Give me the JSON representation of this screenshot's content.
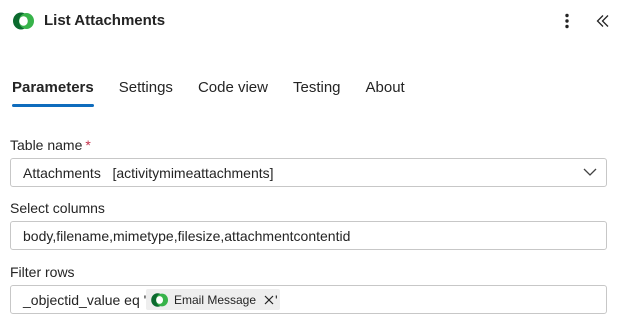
{
  "header": {
    "title": "List Attachments",
    "more_icon": "more-vertical-icon",
    "collapse_icon": "double-chevron-left-icon"
  },
  "tabs": [
    {
      "label": "Parameters",
      "active": true
    },
    {
      "label": "Settings",
      "active": false
    },
    {
      "label": "Code view",
      "active": false
    },
    {
      "label": "Testing",
      "active": false
    },
    {
      "label": "About",
      "active": false
    }
  ],
  "fields": {
    "table_name": {
      "label": "Table name",
      "required_mark": "*",
      "value": "Attachments   [activitymimeattachments]"
    },
    "select_columns": {
      "label": "Select columns",
      "value": "body,filename,mimetype,filesize,attachmentcontentid"
    },
    "filter_rows": {
      "label": "Filter rows",
      "prefix": "_objectid_value eq '",
      "token_label": "Email Message",
      "suffix": "'"
    }
  },
  "colors": {
    "accent": "#0f6cbd",
    "required": "#c4314b",
    "logo_dark": "#0b6a2e",
    "logo_light": "#37b34a"
  }
}
